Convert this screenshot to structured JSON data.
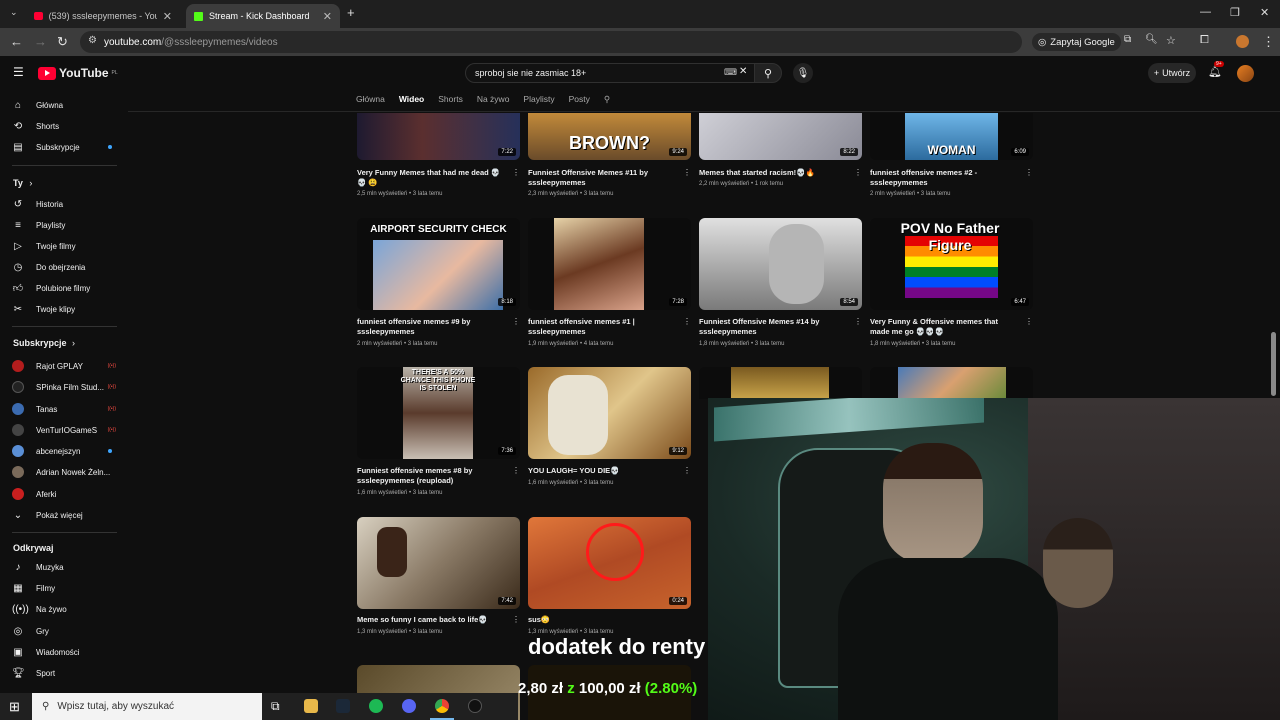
{
  "browser": {
    "tabs": [
      {
        "title": "(539) sssleepymemes - YouTub"
      },
      {
        "title": "Stream - Kick Dashboard"
      }
    ],
    "url_domain": "youtube.com",
    "url_path": "/@sssleepymemes/videos",
    "ask_google": "Zapytaj Google"
  },
  "youtube": {
    "logo": "YouTube",
    "logo_region": "PL",
    "search_value": "sproboj sie nie zasmiac 18+",
    "create_label": "Utwórz",
    "notifications_badge": "9+",
    "sidebar": {
      "main": [
        "Główna",
        "Shorts",
        "Subskrypcje"
      ],
      "you_header": "Ty",
      "you_items": [
        "Historia",
        "Playlisty",
        "Twoje filmy",
        "Do obejrzenia",
        "Polubione filmy",
        "Twoje klipy"
      ],
      "subs_header": "Subskrypcje",
      "subs": [
        "Rajot GPLAY",
        "SPinka Film Stud...",
        "Tanas",
        "VenTurIOGameS",
        "abcenejszyn",
        "Adrian Nowek Żeln...",
        "Aferki"
      ],
      "show_more": "Pokaż więcej",
      "explore_header": "Odkrywaj",
      "explore_items": [
        "Muzyka",
        "Filmy",
        "Na żywo",
        "Gry",
        "Wiadomości",
        "Sport"
      ]
    },
    "channel_tabs": [
      "Główna",
      "Wideo",
      "Shorts",
      "Na żywo",
      "Playlisty",
      "Posty"
    ],
    "videos": [
      {
        "title": "Very Funny Memes that had me dead 💀💀 😩",
        "meta": "2,5 mln wyświetleń • 3 lata temu",
        "duration": "7:22",
        "thumb_text": ""
      },
      {
        "title": "Funniest Offensive Memes #11 by sssleepymemes",
        "meta": "2,3 mln wyświetleń • 3 lata temu",
        "duration": "9:24",
        "thumb_text": "BROWN?"
      },
      {
        "title": "Memes that started racism!💀🔥",
        "meta": "2,2 mln wyświetleń • 1 rok temu",
        "duration": "8:22",
        "thumb_text": ""
      },
      {
        "title": "funniest offensive memes #2 - sssleepymemes",
        "meta": "2 mln wyświetleń • 3 lata temu",
        "duration": "6:09",
        "thumb_text": "WOMAN"
      },
      {
        "title": "funniest offensive memes #9 by sssleepymemes",
        "meta": "2 mln wyświetleń • 3 lata temu",
        "duration": "8:18",
        "thumb_text": "AIRPORT SECURITY CHECK"
      },
      {
        "title": "funniest offensive memes #1 | sssleepymemes",
        "meta": "1,9 mln wyświetleń • 4 lata temu",
        "duration": "7:28",
        "thumb_text": ""
      },
      {
        "title": "Funniest Offensive Memes #14 by sssleepymemes",
        "meta": "1,8 mln wyświetleń • 3 lata temu",
        "duration": "8:54",
        "thumb_text": ""
      },
      {
        "title": "Very Funny & Offensive memes that made me go 💀💀💀",
        "meta": "1,8 mln wyświetleń • 3 lata temu",
        "duration": "6:47",
        "thumb_text": "POV No Father Figure"
      },
      {
        "title": "Funniest offensive memes #8 by sssleepymemes (reupload)",
        "meta": "1,6 mln wyświetleń • 3 lata temu",
        "duration": "7:36",
        "thumb_text": "THERE'S A 50% CHANCE THIS PHONE IS STOLEN"
      },
      {
        "title": "YOU LAUGH= YOU DIE💀",
        "meta": "1,6 mln wyświetleń • 3 lata temu",
        "duration": "9:12",
        "thumb_text": ""
      },
      {
        "title": "Meme so funny I came back to life💀",
        "meta": "1,3 mln wyświetleń • 3 lata temu",
        "duration": "7:42",
        "thumb_text": ""
      },
      {
        "title": "sus😳",
        "meta": "1,3 mln wyświetleń • 3 lata temu",
        "duration": "0:24",
        "thumb_text": ""
      }
    ]
  },
  "overlay": {
    "line1": "dodatek do renty",
    "amount_current": "2,80 zł",
    "amount_of": "z",
    "amount_goal": "100,00 zł",
    "percent": "(2.80%)",
    "progress": 0.028
  },
  "taskbar": {
    "search_placeholder": "Wpisz tutaj, aby wyszukać"
  },
  "colors": {
    "yt_red": "#ff0033",
    "kick_green": "#53fc18",
    "bg": "#0f0f0f"
  }
}
